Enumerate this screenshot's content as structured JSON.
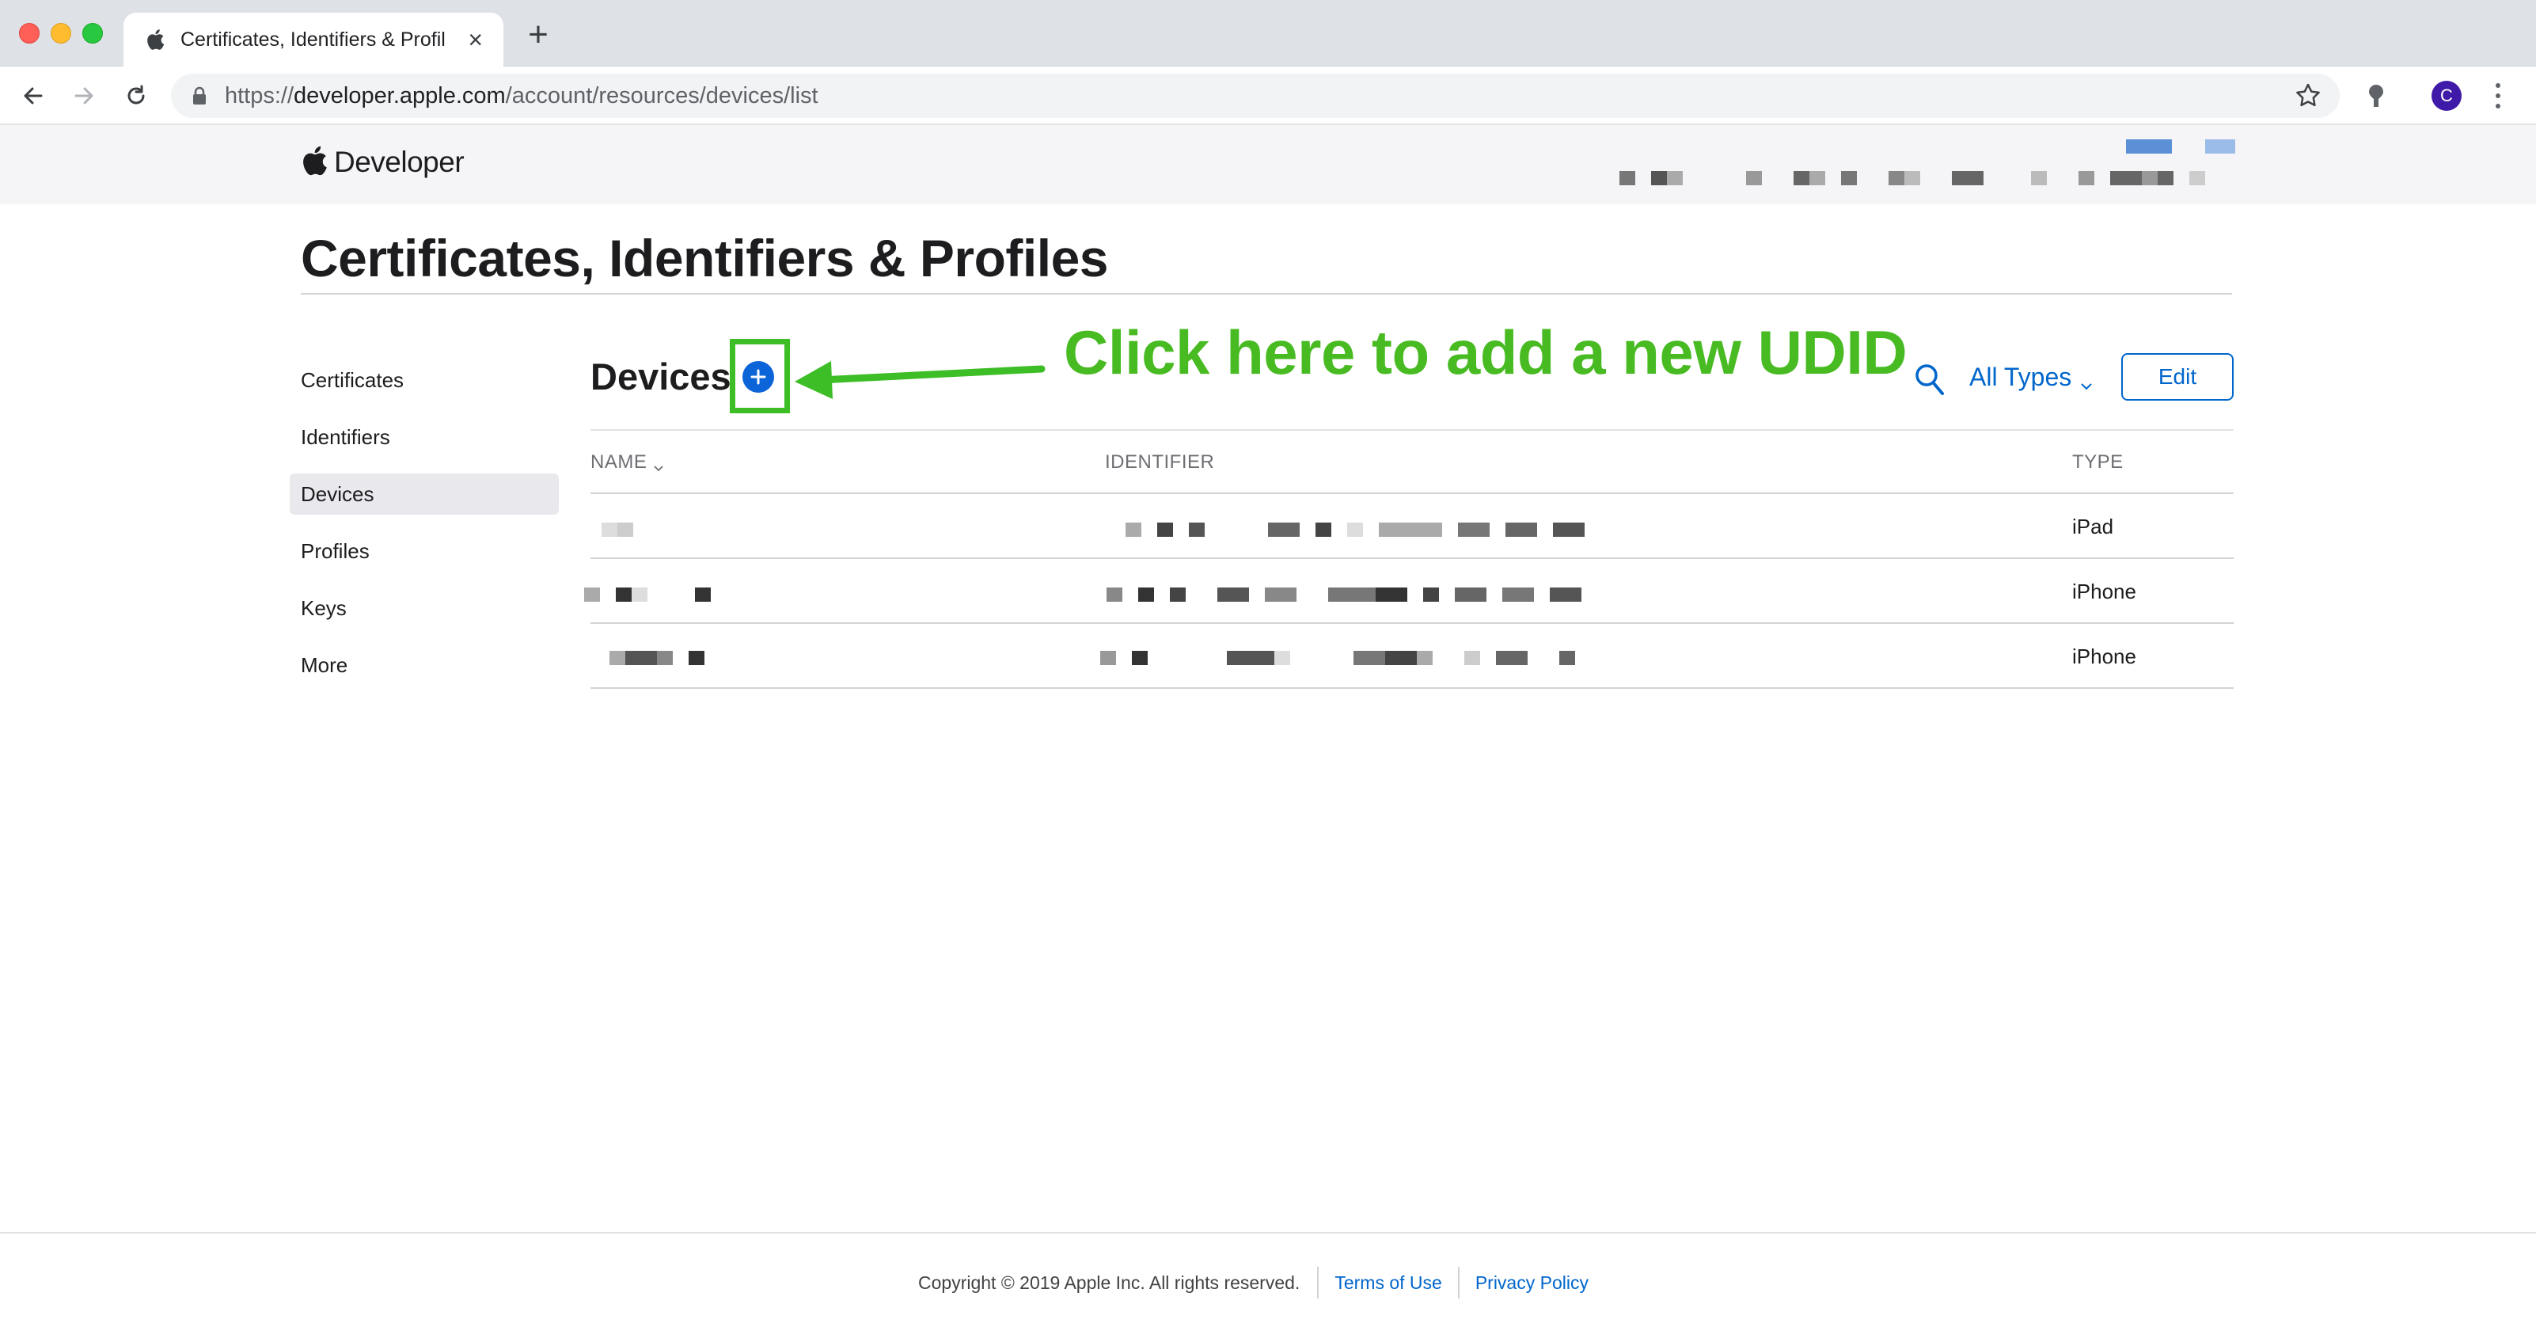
{
  "browser": {
    "tab_title": "Certificates, Identifiers & Profil",
    "url_scheme": "https://",
    "url_host": "developer.apple.com",
    "url_path": "/account/resources/devices/list",
    "profile_initial": "C"
  },
  "header": {
    "brand": "Developer"
  },
  "page": {
    "title": "Certificates, Identifiers & Profiles"
  },
  "sidebar": {
    "items": [
      {
        "label": "Certificates"
      },
      {
        "label": "Identifiers"
      },
      {
        "label": "Devices"
      },
      {
        "label": "Profiles"
      },
      {
        "label": "Keys"
      },
      {
        "label": "More"
      }
    ],
    "active": "Devices"
  },
  "devices": {
    "section_title": "Devices",
    "filter_label": "All Types",
    "edit_label": "Edit",
    "columns": {
      "name": "NAME",
      "identifier": "IDENTIFIER",
      "type": "TYPE"
    },
    "rows": [
      {
        "type": "iPad"
      },
      {
        "type": "iPhone"
      },
      {
        "type": "iPhone"
      }
    ]
  },
  "annotation": {
    "callout": "Click here to add a new UDID",
    "color": "#48bb22"
  },
  "footer": {
    "copyright": "Copyright © 2019 Apple Inc. All rights reserved.",
    "terms": "Terms of Use",
    "privacy": "Privacy Policy"
  },
  "colors": {
    "accent": "#0066cc",
    "add_button": "#0b64d8",
    "highlight": "#3dbd26"
  },
  "icons": [
    "apple-icon",
    "close-icon",
    "plus-icon",
    "back-icon",
    "forward-icon",
    "reload-icon",
    "lock-icon",
    "star-icon",
    "location-icon",
    "search-icon",
    "chevron-down-icon",
    "add-icon",
    "more-icon"
  ]
}
